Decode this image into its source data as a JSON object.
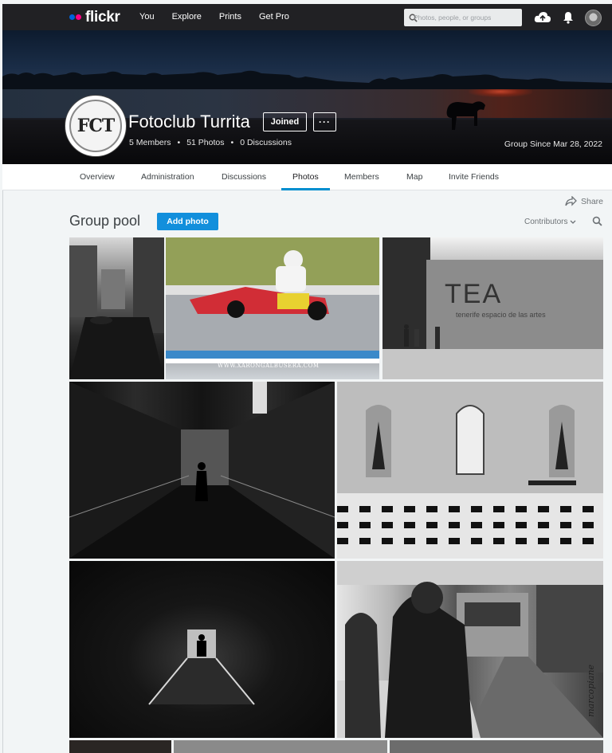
{
  "nav": {
    "logo_text": "flickr",
    "links": [
      "You",
      "Explore",
      "Prints",
      "Get Pro"
    ],
    "search_placeholder": "Photos, people, or groups"
  },
  "group": {
    "name": "Fotoclub Turrita",
    "avatar_text": "FCT",
    "joined_label": "Joined",
    "more_label": "···",
    "members": "5 Members",
    "photos": "51 Photos",
    "discussions": "0 Discussions",
    "since": "Group Since Mar 28, 2022"
  },
  "tabs": [
    "Overview",
    "Administration",
    "Discussions",
    "Photos",
    "Members",
    "Map",
    "Invite Friends"
  ],
  "active_tab": "Photos",
  "share_label": "Share",
  "pool": {
    "title": "Group pool",
    "add_photo_label": "Add photo",
    "contributors_label": "Contributors"
  },
  "photos": {
    "p2_caption": "WWW.XARONGALBUSERA.COM",
    "p3_sign": "TEA",
    "p3_sign_sub": "tenerife espacio de las artes",
    "p7_watermark": "marcopiane"
  },
  "colors": {
    "accent": "#008ecf",
    "button": "#128fdc",
    "nav_bg": "#212124",
    "flickr_blue": "#0063dc",
    "flickr_pink": "#ff0084"
  }
}
